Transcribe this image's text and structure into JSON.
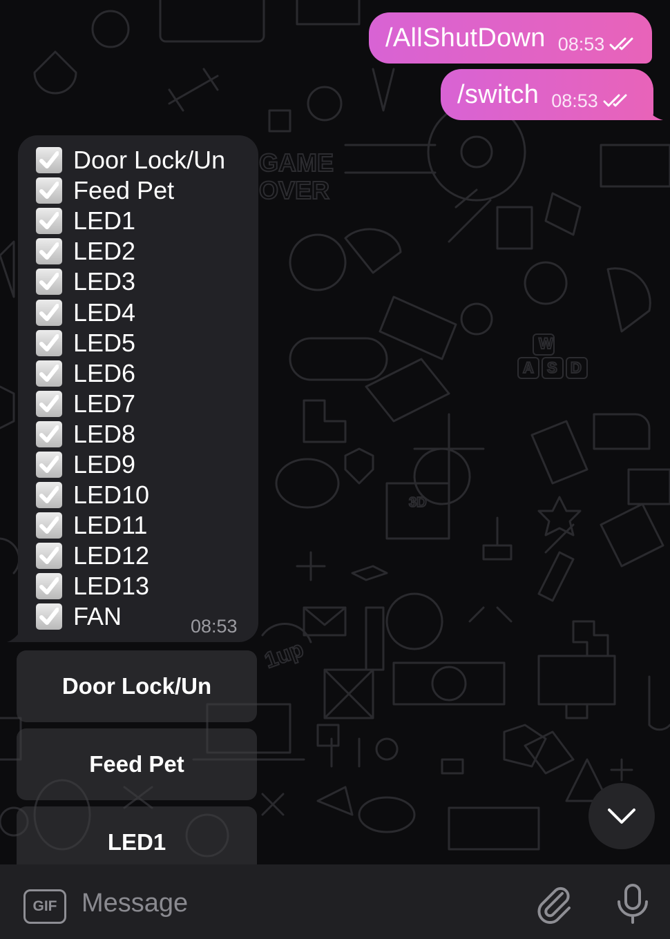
{
  "outgoing": [
    {
      "text": "/AllShutDown",
      "time": "08:53"
    },
    {
      "text": "/switch",
      "time": "08:53"
    }
  ],
  "incoming": {
    "items": [
      "Door Lock/Un",
      "Feed Pet",
      "LED1",
      "LED2",
      "LED3",
      "LED4",
      "LED5",
      "LED6",
      "LED7",
      "LED8",
      "LED9",
      "LED10",
      "LED11",
      "LED12",
      "LED13",
      "FAN"
    ],
    "time": "08:53"
  },
  "keyboard": {
    "buttons": [
      "Door Lock/Un",
      "Feed Pet",
      "LED1"
    ]
  },
  "wallpaper_text": [
    "GAME",
    "OVER",
    "1up",
    "W",
    "A",
    "S",
    "D",
    "3D"
  ],
  "input": {
    "placeholder": "Message",
    "gif_label": "GIF"
  },
  "icons": {
    "check": "checkmark-icon",
    "read": "double-check-icon",
    "scroll": "chevron-down-icon",
    "attach": "paperclip-icon",
    "mic": "microphone-icon"
  },
  "colors": {
    "outgoing_start": "#d863d4",
    "outgoing_end": "#e863b9",
    "incoming_bubble": "#222226",
    "background": "#0c0c0e",
    "input_bar": "#202023"
  }
}
